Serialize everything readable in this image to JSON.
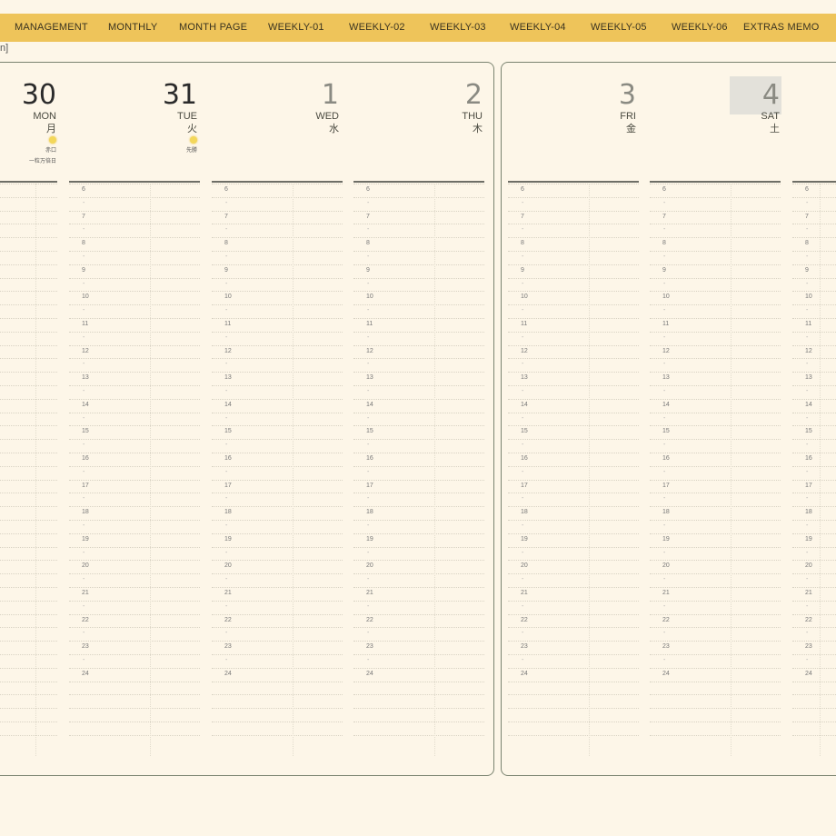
{
  "tabs": [
    {
      "label": "MANAGEMENT"
    },
    {
      "label": "MONTHLY"
    },
    {
      "label": "MONTH PAGE"
    },
    {
      "label": "WEEKLY-01"
    },
    {
      "label": "WEEKLY-02"
    },
    {
      "label": "WEEKLY-03"
    },
    {
      "label": "WEEKLY-04"
    },
    {
      "label": "WEEKLY-05"
    },
    {
      "label": "WEEKLY-06"
    },
    {
      "label": "EXTRAS MEMO"
    }
  ],
  "corner_text": "n]",
  "days": [
    {
      "num": "30",
      "name": "MON",
      "kanji": "月",
      "moon": true,
      "note1": "赤口",
      "note2": "一粒万倍日"
    },
    {
      "num": "31",
      "name": "TUE",
      "kanji": "火",
      "moon": true,
      "note1": "先勝",
      "note2": ""
    },
    {
      "num": "1",
      "name": "WED",
      "kanji": "水",
      "moon": false,
      "note1": "",
      "note2": ""
    },
    {
      "num": "2",
      "name": "THU",
      "kanji": "木",
      "moon": false,
      "note1": "",
      "note2": ""
    },
    {
      "num": "3",
      "name": "FRI",
      "kanji": "金",
      "moon": false,
      "note1": "",
      "note2": ""
    },
    {
      "num": "4",
      "name": "SAT",
      "kanji": "土",
      "moon": false,
      "note1": "",
      "note2": ""
    }
  ],
  "hours": [
    "6",
    "7",
    "8",
    "9",
    "10",
    "11",
    "12",
    "13",
    "14",
    "15",
    "16",
    "17",
    "18",
    "19",
    "20",
    "21",
    "22",
    "23",
    "24"
  ],
  "colors": {
    "tabbar": "#eec45a",
    "background": "#fdf6e8",
    "border": "#7a8370",
    "past_day": "#2b2b2b",
    "future_day": "#8a8a82"
  }
}
